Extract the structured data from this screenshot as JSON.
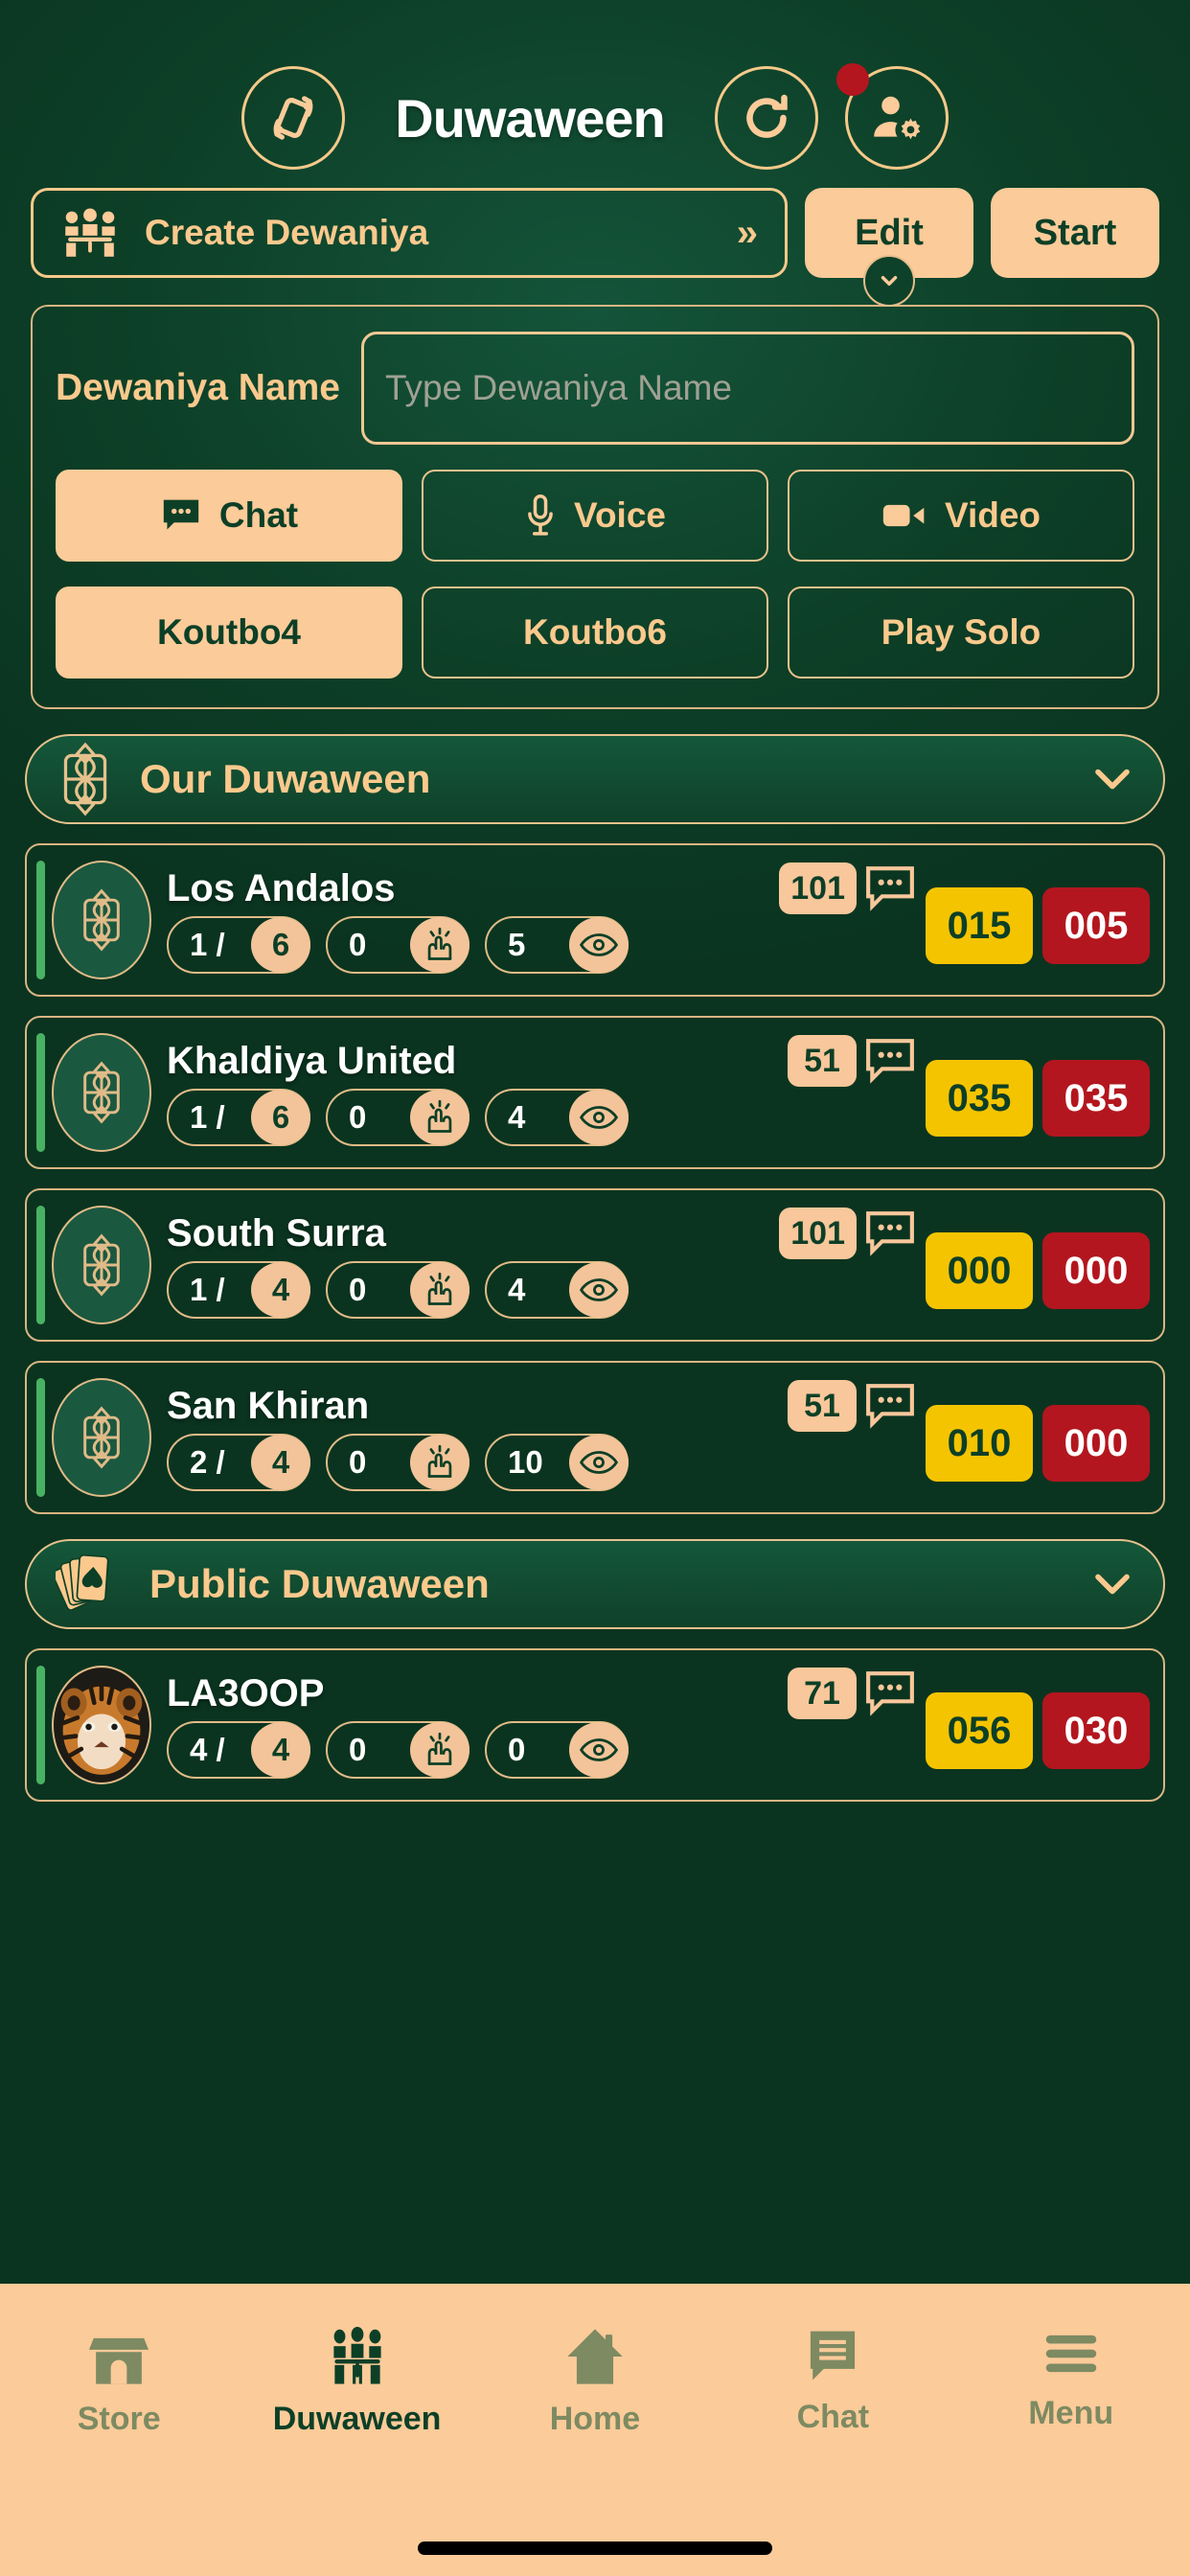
{
  "header": {
    "title": "Duwaween",
    "rotate_icon": "rotate-device-icon",
    "refresh_icon": "refresh-icon",
    "profile_icon": "profile-settings-icon",
    "has_notification_dot": true,
    "notification_color": "#b3161e"
  },
  "actions": {
    "create_label": "Create Dewaniya",
    "create_icon": "people-at-table-icon",
    "create_chevron": "»",
    "edit_label": "Edit",
    "start_label": "Start",
    "edit_caret_icon": "chevron-down-icon"
  },
  "form": {
    "name_label": "Dewaniya Name",
    "name_value": "",
    "name_placeholder": "Type Dewaniya Name",
    "mode_options": [
      {
        "label": "Chat",
        "icon": "chat-bubble-icon",
        "selected": true
      },
      {
        "label": "Voice",
        "icon": "microphone-icon",
        "selected": false
      },
      {
        "label": "Video",
        "icon": "video-camera-icon",
        "selected": false
      }
    ],
    "game_options": [
      {
        "label": "Koutbo4",
        "selected": true
      },
      {
        "label": "Koutbo6",
        "selected": false
      },
      {
        "label": "Play Solo",
        "selected": false
      }
    ]
  },
  "sections": [
    {
      "title": "Our Duwaween",
      "icon": "ornament-emblem-icon",
      "caret": "chevron-down-icon"
    },
    {
      "title": "Public Duwaween",
      "icon": "playing-cards-icon",
      "caret": "chevron-down-icon"
    }
  ],
  "our_rooms": [
    {
      "name": "Los Andalos",
      "avatar": "ornament-emblem-icon",
      "players_current": "1",
      "players_max": "6",
      "cheer_count": "0",
      "viewers": "5",
      "message_count": "101",
      "score_gold": "015",
      "score_red": "005"
    },
    {
      "name": "Khaldiya United",
      "avatar": "ornament-emblem-icon",
      "players_current": "1",
      "players_max": "6",
      "cheer_count": "0",
      "viewers": "4",
      "message_count": "51",
      "score_gold": "035",
      "score_red": "035"
    },
    {
      "name": "South Surra",
      "avatar": "ornament-emblem-icon",
      "players_current": "1",
      "players_max": "4",
      "cheer_count": "0",
      "viewers": "4",
      "message_count": "101",
      "score_gold": "000",
      "score_red": "000"
    },
    {
      "name": "San Khiran",
      "avatar": "ornament-emblem-icon",
      "players_current": "2",
      "players_max": "4",
      "cheer_count": "0",
      "viewers": "10",
      "message_count": "51",
      "score_gold": "010",
      "score_red": "000"
    }
  ],
  "public_rooms": [
    {
      "name": "LA3OOP",
      "avatar": "tiger-photo-avatar",
      "players_current": "4",
      "players_max": "4",
      "cheer_count": "0",
      "viewers": "0",
      "message_count": "71",
      "score_gold": "056",
      "score_red": "030"
    }
  ],
  "bottom_nav": [
    {
      "label": "Store",
      "icon": "store-icon",
      "active": false
    },
    {
      "label": "Duwaween",
      "icon": "people-at-table-icon",
      "active": true
    },
    {
      "label": "Home",
      "icon": "home-icon",
      "active": false
    },
    {
      "label": "Chat",
      "icon": "chat-icon",
      "active": false
    },
    {
      "label": "Menu",
      "icon": "hamburger-menu-icon",
      "active": false
    }
  ],
  "colors": {
    "background_green": "#0d3f27",
    "accent_peach": "#fbcb99",
    "gold_border": "#e0bb88",
    "score_gold": "#f5c400",
    "score_red": "#b3161e",
    "live_green": "#49b262"
  }
}
